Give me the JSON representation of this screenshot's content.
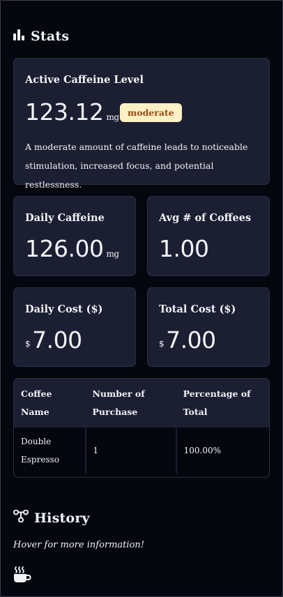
{
  "stats": {
    "title": "Stats",
    "active": {
      "label": "Active Caffeine Level",
      "value": "123.12",
      "unit": "mg",
      "badge": "moderate",
      "description": "A moderate amount of caffeine leads to noticeable stimulation, increased focus, and potential restlessness."
    },
    "daily_caffeine": {
      "label": "Daily Caffeine",
      "value": "126.00",
      "unit": "mg"
    },
    "avg_coffees": {
      "label": "Avg # of Coffees",
      "value": "1.00"
    },
    "daily_cost": {
      "label": "Daily Cost ($)",
      "currency": "$",
      "value": "7.00"
    },
    "total_cost": {
      "label": "Total Cost ($)",
      "currency": "$",
      "value": "7.00"
    }
  },
  "table": {
    "headers": [
      "Coffee Name",
      "Number of Purchase",
      "Percentage of Total"
    ],
    "rows": [
      [
        "Double Espresso",
        "1",
        "100.00%"
      ]
    ]
  },
  "history": {
    "title": "History",
    "hint": "Hover for more information!"
  },
  "icons": {
    "stats": "bar-chart-icon",
    "history": "timeline-icon",
    "coffee": "coffee-cup-icon"
  }
}
